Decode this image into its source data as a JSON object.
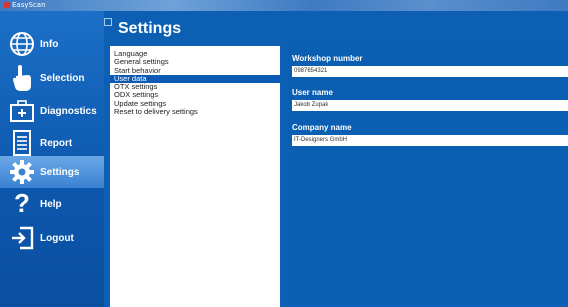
{
  "window": {
    "title": "EasyScan"
  },
  "sidebar": {
    "items": [
      {
        "label": "Info",
        "icon": "globe-icon"
      },
      {
        "label": "Selection",
        "icon": "hand-pointer-icon"
      },
      {
        "label": "Diagnostics",
        "icon": "medical-case-icon"
      },
      {
        "label": "Report",
        "icon": "document-icon"
      },
      {
        "label": "Settings",
        "icon": "gear-icon",
        "active": true
      },
      {
        "label": "Help",
        "icon": "question-icon"
      },
      {
        "label": "Logout",
        "icon": "logout-icon"
      }
    ]
  },
  "main": {
    "title": "Settings",
    "menu": [
      "Language",
      "General settings",
      "Start behavior",
      "User data",
      "OTX settings",
      "ODX settings",
      "Update settings",
      "Reset to delivery settings"
    ],
    "selected_index": 3,
    "fields": [
      {
        "label": "Workshop number",
        "value": "0987654321"
      },
      {
        "label": "User name",
        "value": "Jakob Zupak"
      },
      {
        "label": "Company name",
        "value": "IT-Designers GmbH"
      }
    ]
  },
  "colors": {
    "accent": "#0d5fb3",
    "sidebar": "#0c57ad",
    "selected": "#0b5bb5"
  }
}
